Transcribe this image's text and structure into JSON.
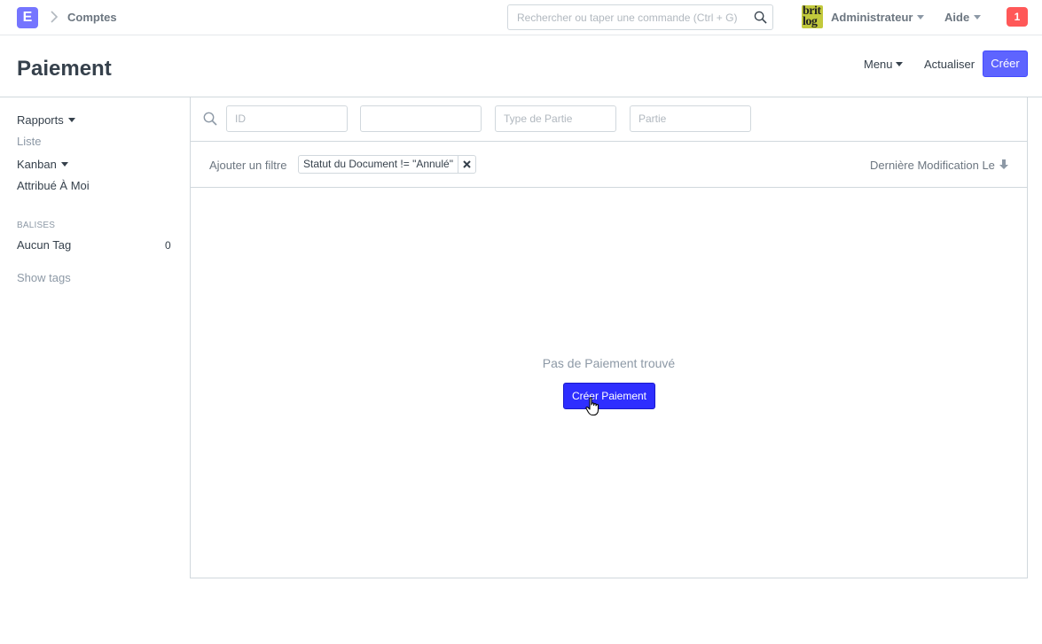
{
  "navbar": {
    "app_logo": "E",
    "breadcrumb": "Comptes",
    "search_placeholder": "Rechercher ou taper une commande (Ctrl + G)",
    "brand_logo_line1": "brit",
    "brand_logo_line2": "log",
    "user": "Administrateur",
    "help": "Aide",
    "notification_count": "1"
  },
  "page": {
    "title": "Paiement",
    "menu_label": "Menu",
    "refresh_label": "Actualiser",
    "create_label": "Créer"
  },
  "sidebar": {
    "reports": "Rapports",
    "list": "Liste",
    "kanban": "Kanban",
    "assigned_to_me": "Attribué À Moi",
    "tags_heading": "BALISES",
    "no_tag": "Aucun Tag",
    "no_tag_count": "0",
    "show_tags": "Show tags"
  },
  "filters": {
    "id_placeholder": "ID",
    "second_value": "",
    "party_type_placeholder": "Type de Partie",
    "party_placeholder": "Partie",
    "add_filter": "Ajouter un filtre",
    "active_filter": "Statut du Document != \"Annulé\"",
    "sort_label": "Dernière Modification Le"
  },
  "empty": {
    "message": "Pas de Paiement trouvé",
    "create_button": "Créer Paiement"
  },
  "colors": {
    "primary": "#5e64ff",
    "logo": "#7575ff",
    "notification": "#ff5858",
    "empty_create": "#2e2eff"
  }
}
